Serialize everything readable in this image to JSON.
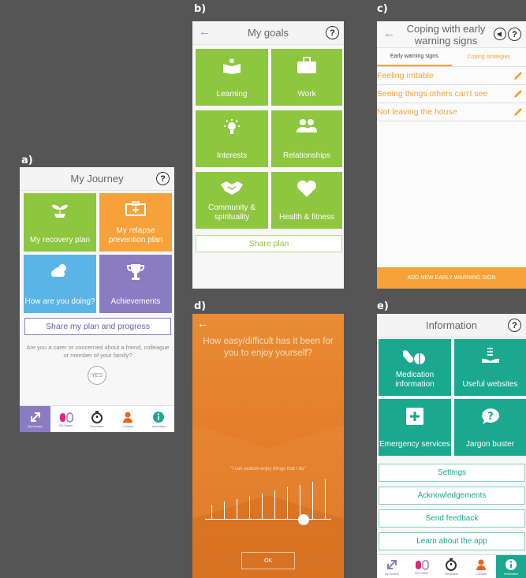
{
  "labels": {
    "a": "a)",
    "b": "b)",
    "c": "c)",
    "d": "d)",
    "e": "e)"
  },
  "journey": {
    "title": "My Journey",
    "help": "?",
    "tiles": [
      "My recovery plan",
      "My relapse prevention plan",
      "How are you doing?",
      "Achievements"
    ],
    "share": "Share my plan and progress",
    "carer_text": "Are you a carer or concerned about a friend, colleague or member of your family?",
    "yes": "YES",
    "nav": [
      "My Journey",
      "Pill Tracker",
      "Reminders",
      "Contacts",
      "Information"
    ]
  },
  "goals": {
    "title": "My goals",
    "back": "←",
    "help": "?",
    "tiles": [
      "Learning",
      "Work",
      "Interests",
      "Relationships",
      "Community & spirituality",
      "Health & fitness"
    ],
    "share": "Share plan"
  },
  "coping": {
    "title": "Coping with early warning signs",
    "back": "←",
    "help": "?",
    "tabs": [
      "Early warning signs",
      "Coping strategies"
    ],
    "signs": [
      "Feeling irritable",
      "Seeing things others can't see",
      "Not leaving the house"
    ],
    "add": "ADD NEW EARLY WARNING SIGN"
  },
  "rating": {
    "back": "←",
    "question": "How easy/difficult has it been for you to enjoy yourself?",
    "answer": "\"I can seldom enjoy things that I do\"",
    "ok": "OK",
    "level": 0.78
  },
  "info": {
    "title": "Information",
    "help": "?",
    "tiles": [
      "Medication information",
      "Useful websites",
      "Emergency services",
      "Jargon buster"
    ],
    "links": [
      "Settings",
      "Acknowledgements",
      "Send feedback",
      "Learn about the app"
    ],
    "nav": [
      "My Journey",
      "Pill Tracker",
      "Reminders",
      "Contacts",
      "Information"
    ]
  },
  "colors": {
    "green": "#8dc63f",
    "orange": "#f6a13a",
    "blue": "#5ab4e5",
    "purple": "#8a7cc1",
    "teal": "#1aa88f"
  }
}
